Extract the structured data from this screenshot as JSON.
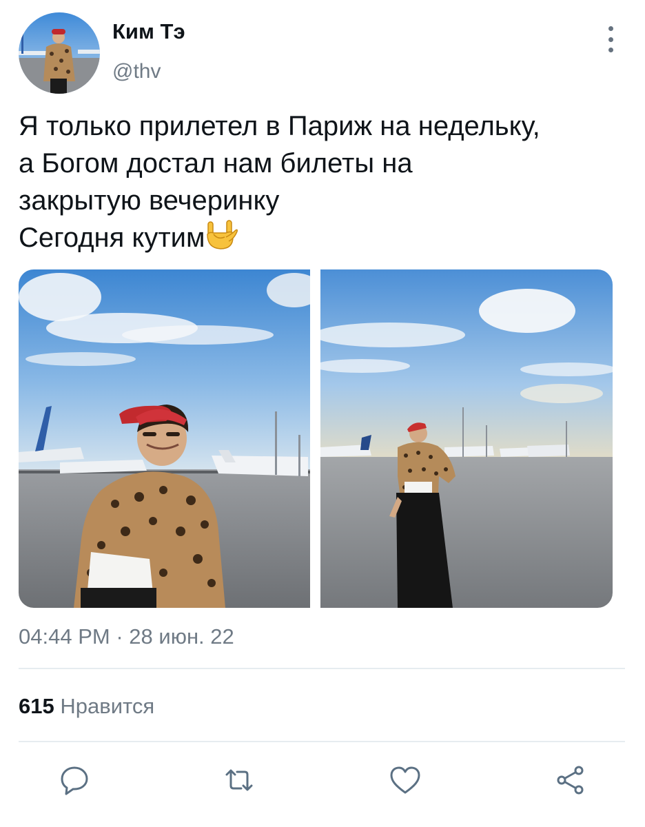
{
  "user": {
    "display_name": "Ким Тэ",
    "handle": "@thv"
  },
  "tweet": {
    "lines": [
      "Я только прилетел в Париж на недельку,",
      "а Богом достал нам билеты на",
      "закрытую вечеринку",
      "Сегодня кутим"
    ],
    "emoji": "rock-on-hand-emoji"
  },
  "media": [
    {
      "icon": "photo-man-in-leopard-shirt-close-up-airfield"
    },
    {
      "icon": "photo-man-in-leopard-shirt-full-length-airfield"
    }
  ],
  "meta": {
    "time": "04:44 PM",
    "separator": "·",
    "date": "28 июн. 22"
  },
  "stats": {
    "likes_count": "615",
    "likes_label": "Нравится"
  },
  "actions": {
    "reply_icon": "reply-icon",
    "retweet_icon": "retweet-icon",
    "like_icon": "heart-icon",
    "share_icon": "share-icon"
  },
  "colors": {
    "text": "#0f1419",
    "secondary": "#6f7a85",
    "icon": "#5b7083",
    "divider": "#e6ecf0",
    "sky": "#4a90d9",
    "tarmac": "#86898d"
  }
}
